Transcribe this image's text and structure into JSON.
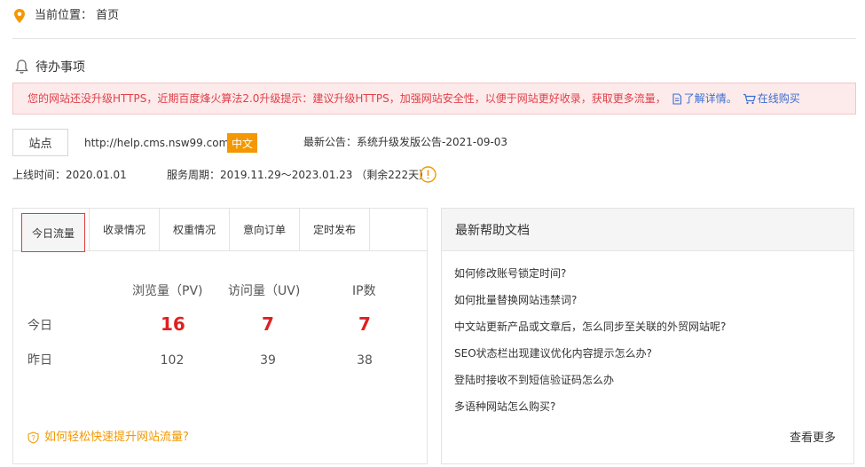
{
  "header": {
    "location_label": "当前位置：  首页",
    "todo_title": "待办事项"
  },
  "notice": {
    "text": "您的网站还没升级HTTPS，近期百度烽火算法2.0升级提示：建议升级HTTPS，加强网站安全性，以便于网站更好收录，获取更多流量，",
    "link_details": "了解详情。",
    "link_buy": "在线购买"
  },
  "site": {
    "button_label": "站点",
    "url": "http://help.cms.nsw99.com",
    "lang_badge": "中文",
    "announcement": "最新公告：系统升级发版公告-2021-09-03",
    "online_time": "上线时间：2020.01.01",
    "service_period": "服务周期：2019.11.29～2023.01.23  （剩余222天）"
  },
  "stats": {
    "tabs": [
      "今日流量",
      "收录情况",
      "权重情况",
      "意向订单",
      "定时发布"
    ],
    "columns": [
      "浏览量（PV)",
      "访问量（UV)",
      "IP数"
    ],
    "rows": [
      {
        "label": "今日",
        "values": [
          "16",
          "7",
          "7"
        ]
      },
      {
        "label": "昨日",
        "values": [
          "102",
          "39",
          "38"
        ]
      }
    ],
    "tip": "如何轻松快速提升网站流量?"
  },
  "help": {
    "title": "最新帮助文档",
    "items": [
      "如何修改账号锁定时间?",
      "如何批量替换网站违禁词?",
      "中文站更新产品或文章后，怎么同步至关联的外贸网站呢?",
      "SEO状态栏出现建议优化内容提示怎么办?",
      "登陆时接收不到短信验证码怎么办",
      "多语种网站怎么购买?"
    ],
    "more": "查看更多"
  },
  "colors": {
    "accent_orange": "#f39800",
    "highlight_red": "#e02020",
    "notice_bg": "#fdeaea",
    "link_blue": "#3b6fd0"
  }
}
